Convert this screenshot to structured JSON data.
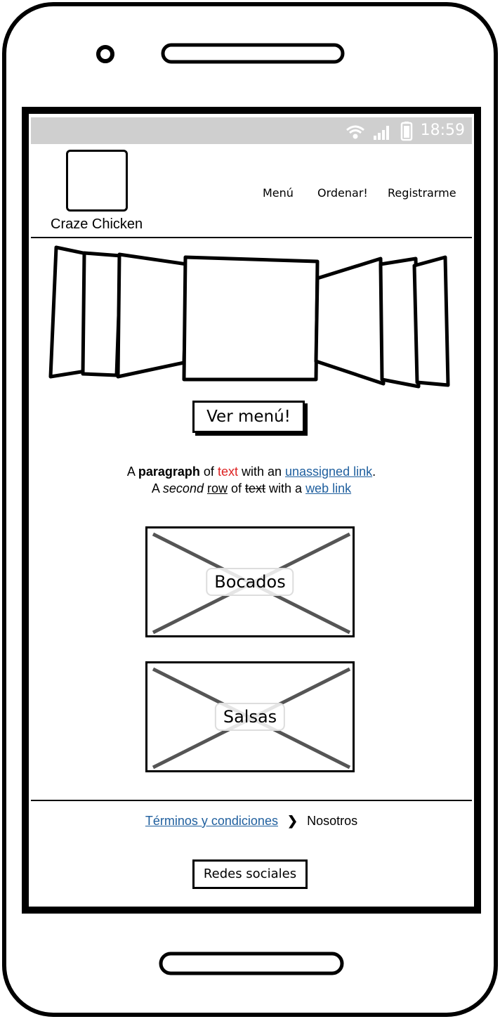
{
  "status_bar": {
    "time": "18:59"
  },
  "header": {
    "brand_name": "Craze Chicken",
    "nav": [
      "Menú",
      "Ordenar!",
      "Registrarme"
    ]
  },
  "hero": {
    "cta_label": "Ver menú!"
  },
  "paragraph": {
    "line1": {
      "a": "A ",
      "bold": "paragraph",
      "b": " of ",
      "red": "text",
      "c": " with an ",
      "link": "unassigned link",
      "d": "."
    },
    "line2": {
      "a": "A ",
      "italic": "second",
      "b": " ",
      "underline": "row",
      "c": " of ",
      "strike": "text",
      "d": " with a ",
      "link": "web link"
    }
  },
  "sections": [
    {
      "label": "Bocados"
    },
    {
      "label": "Salsas"
    }
  ],
  "footer": {
    "breadcrumb_link": "Términos y condiciones",
    "breadcrumb_current": "Nosotros",
    "social_button": "Redes sociales"
  }
}
